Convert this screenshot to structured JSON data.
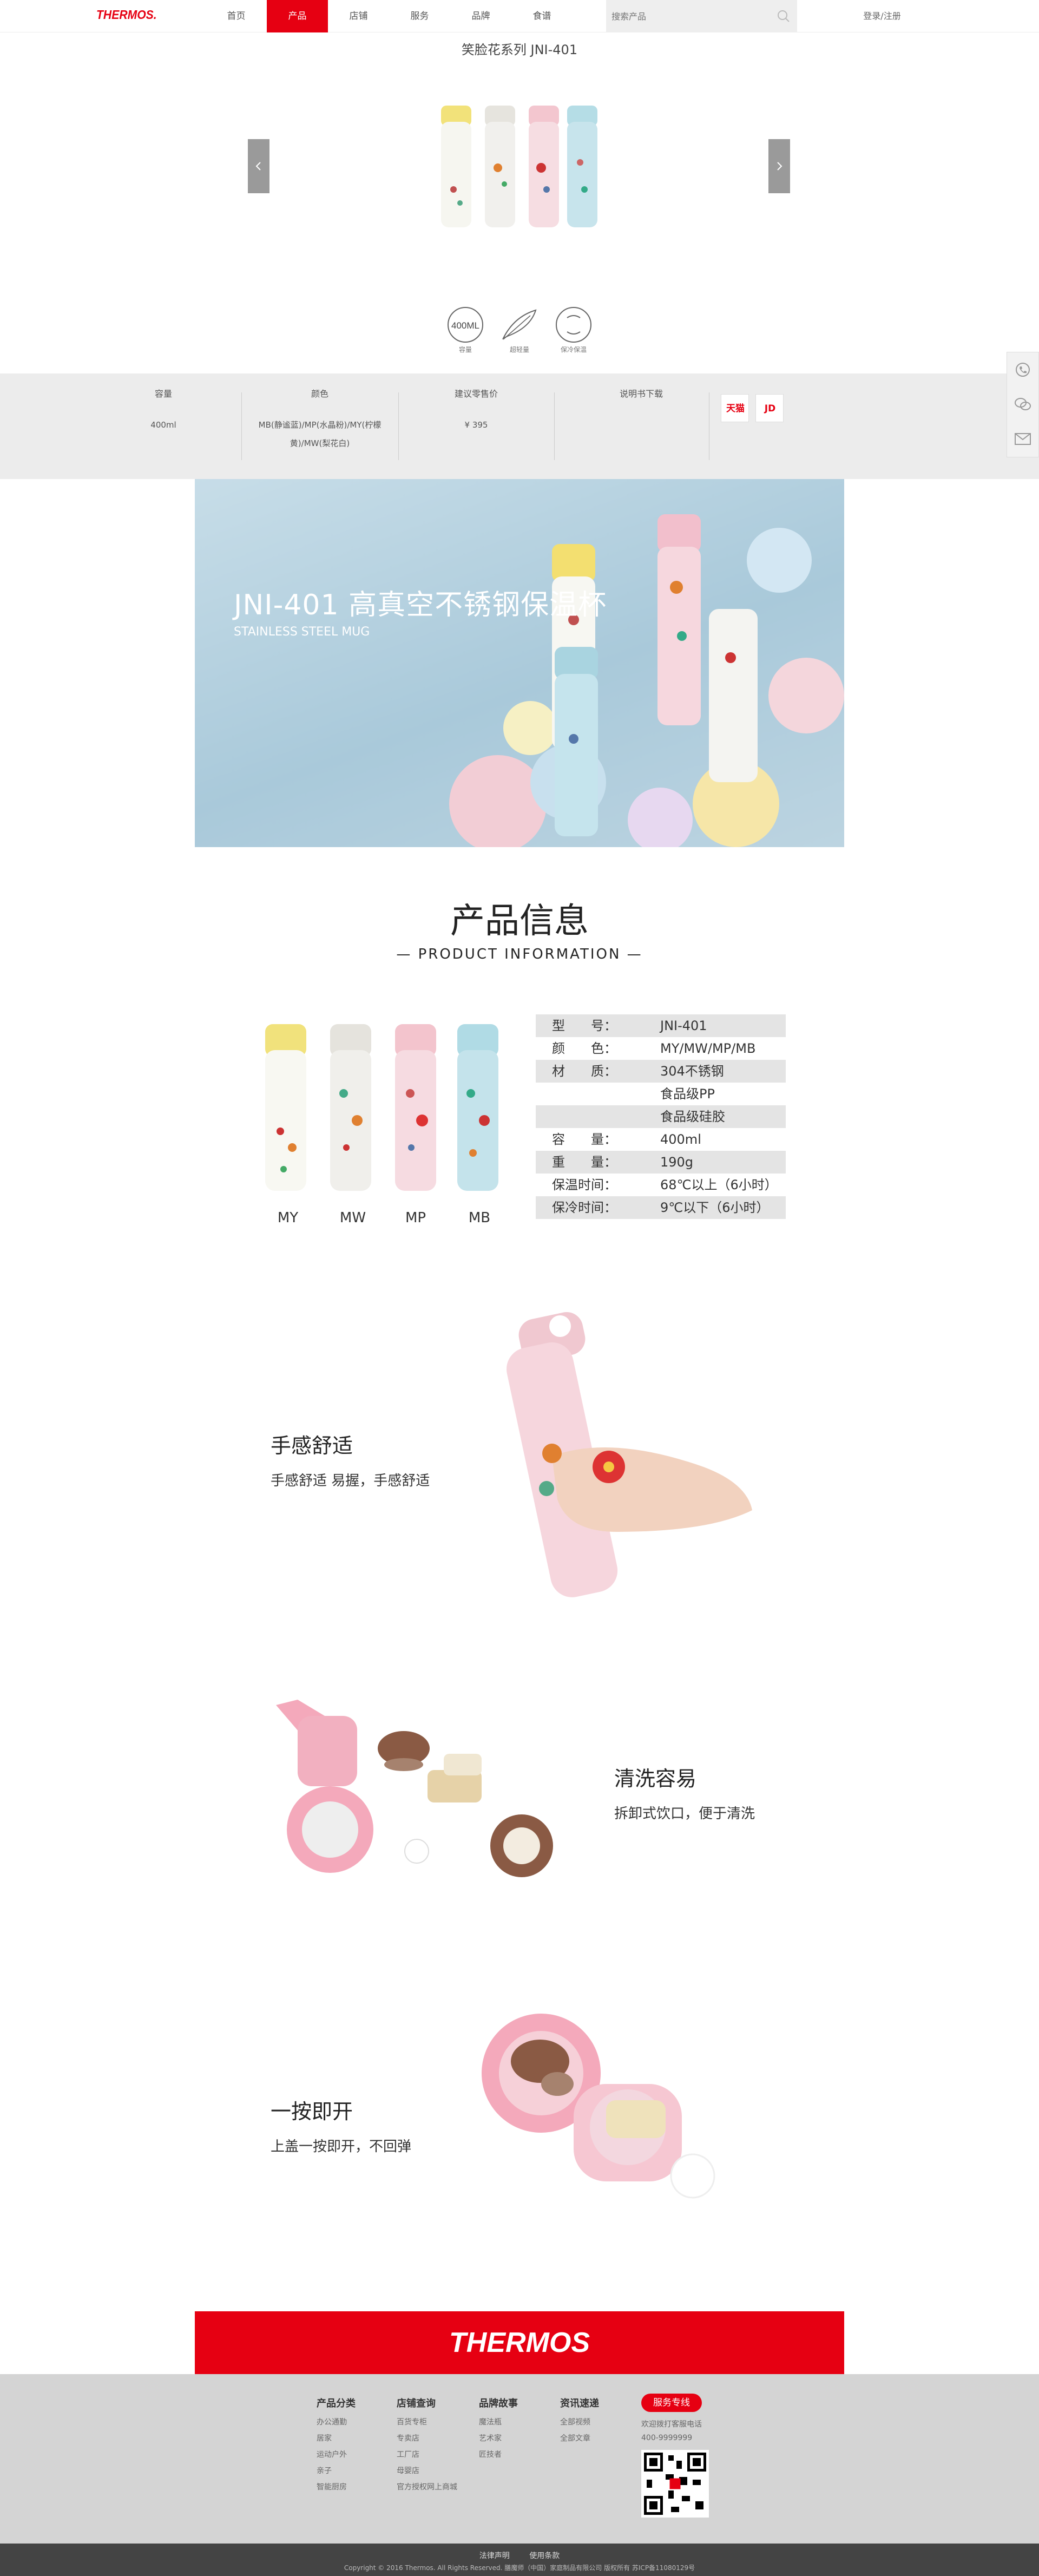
{
  "header": {
    "logo": "THERMOS.",
    "nav": [
      "首页",
      "产品",
      "店铺",
      "服务",
      "品牌",
      "食谱"
    ],
    "active_nav": "产品",
    "search_placeholder": "搜索产品",
    "login": "登录/注册",
    "accent_color": "#e60012"
  },
  "product": {
    "title": "笑脸花系列 JNI-401",
    "spec_icons": [
      {
        "icon": "capacity-icon",
        "badge": "400ML",
        "label": "容量"
      },
      {
        "icon": "feather-icon",
        "badge": "",
        "label": "超轻量"
      },
      {
        "icon": "thermo-icon",
        "badge": "",
        "label": "保冷保温"
      }
    ]
  },
  "specbar": {
    "capacity": {
      "label": "容量",
      "value": "400ml"
    },
    "color": {
      "label": "颜色",
      "value_line1": "MB(静谧蓝)/MP(水晶粉)/MY(柠檬",
      "value_line2": "黄)/MW(梨花白)"
    },
    "price": {
      "label": "建议零售价",
      "value": "¥ 395"
    },
    "manual": {
      "label": "说明书下载"
    },
    "shops": [
      "天猫",
      "JD"
    ]
  },
  "banner": {
    "title": "JNI-401 高真空不锈钢保温杯",
    "subtitle": "STAINLESS STEEL MUG"
  },
  "info": {
    "title": "产品信息",
    "subtitle": "— PRODUCT INFORMATION —",
    "colors": [
      "MY",
      "MW",
      "MP",
      "MB"
    ],
    "table": [
      {
        "k": "型　　号：",
        "v": "JNI-401"
      },
      {
        "k": "颜　　色：",
        "v": "MY/MW/MP/MB"
      },
      {
        "k": "材　　质：",
        "v": "304不锈钢"
      },
      {
        "k": "",
        "v": "食品级PP"
      },
      {
        "k": "",
        "v": "食品级硅胶"
      },
      {
        "k": "容　　量：",
        "v": "400ml"
      },
      {
        "k": "重　　量：",
        "v": "190g"
      },
      {
        "k": "保温时间：",
        "v": "68℃以上（6小时）"
      },
      {
        "k": "保冷时间：",
        "v": "9℃以下（6小时）"
      }
    ]
  },
  "features": [
    {
      "title": "手感舒适",
      "desc": "手感舒适 易握，手感舒适"
    },
    {
      "title": "清洗容易",
      "desc": "拆卸式饮口，便于清洗"
    },
    {
      "title": "一按即开",
      "desc": "上盖一按即开，不回弹"
    }
  ],
  "footer": {
    "logo": "THERMOS",
    "columns": [
      {
        "title": "产品分类",
        "items": [
          "办公通勤",
          "居家",
          "运动户外",
          "亲子",
          "智能厨房"
        ]
      },
      {
        "title": "店铺查询",
        "items": [
          "百货专柜",
          "专卖店",
          "工厂店",
          "母婴店",
          "官方授权网上商城"
        ]
      },
      {
        "title": "品牌故事",
        "items": [
          "魔法瓶",
          "艺术家",
          "匠技者"
        ]
      },
      {
        "title": "资讯速递",
        "items": [
          "全部视频",
          "全部文章"
        ]
      }
    ],
    "hotline_label": "服务专线",
    "hotline_text": "欢迎拨打客服电话",
    "hotline_number": "400-9999999",
    "legal": [
      "法律声明",
      "使用条款"
    ],
    "copyright": "Copyright © 2016 Thermos. All Rights Reserved. 膳魔师（中国）家庭制品有限公司 版权所有 苏ICP备11080129号"
  }
}
